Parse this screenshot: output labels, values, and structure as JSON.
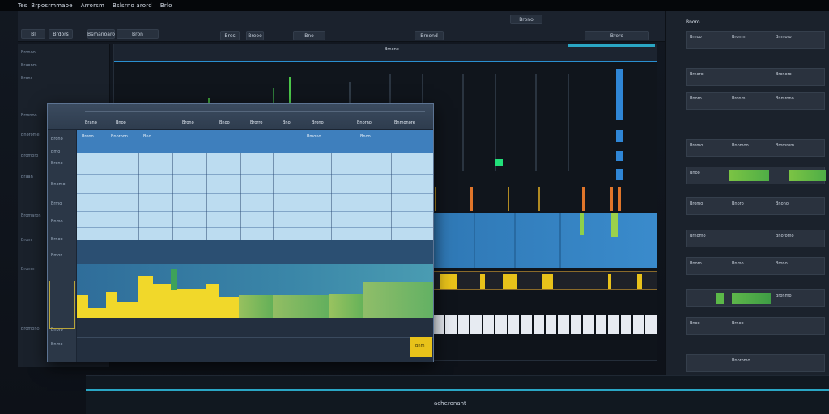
{
  "menubar": {
    "items": [
      "Tesl Brposrmmaoe",
      "Arrorsm",
      "Bslsrno arord",
      "Brlo"
    ]
  },
  "toolbar": {
    "buttons": [
      "Bl",
      "Brdors",
      "Bsmanoaro",
      "Bron",
      "Bros",
      "Breoo",
      "Bno",
      "Brnond",
      "Brono",
      "Broro"
    ]
  },
  "leftbar": {
    "items": [
      "Bronoo",
      "Braonm",
      "Brons",
      "Brmnoo",
      "Bnorome",
      "Bromoro",
      "Braan",
      "Bromaron",
      "Brom",
      "Bronm",
      "Bromono"
    ]
  },
  "arrange": {
    "header_label": "Brnone"
  },
  "float": {
    "header_labels": [
      "Brano",
      "Bnoo",
      "Brono",
      "Bnoo",
      "Brorro",
      "Bno",
      "Brono",
      "Bnorno",
      "Bnmonore"
    ],
    "col_labels": [
      "Brono",
      "Bnoroon",
      "Bno",
      "Bmono",
      "Bnoo"
    ],
    "left_items": [
      "Brono",
      "Bmo",
      "Brono",
      "Bnomo",
      "Brmo",
      "Bnmo",
      "Brnoo",
      "Bmor",
      "Bnoro",
      "Bnmo"
    ],
    "corner_label": "Bnm"
  },
  "mixer": {
    "title": "Bnoro",
    "rows": [
      [
        "Brnoo",
        "Bronm",
        "Bnmoro"
      ],
      [
        "Brnoro",
        "Bronoro"
      ],
      [
        "Bnoro",
        "Bronm",
        "Bnmrono"
      ],
      [
        "Bromo",
        "Bnomoo",
        "Bromrom"
      ],
      [
        "Bnoo",
        "Brnomo",
        "Brnmoo"
      ],
      [
        "Bromo",
        "Bnoro",
        "Bnono"
      ],
      [
        "Brnomo",
        "Bnoromo"
      ],
      [
        "Bnoro",
        "Bnmo",
        "Brono"
      ],
      [
        "Bronmo",
        "Bnoo"
      ],
      [
        "Brnoo",
        "Bnoromo"
      ]
    ]
  },
  "timeline": {
    "label": "acheronant"
  },
  "colors": {
    "accent_blue": "#2f78b5",
    "accent_yellow": "#e8c21a",
    "accent_green": "#6bb84a",
    "accent_orange": "#e0752a"
  }
}
